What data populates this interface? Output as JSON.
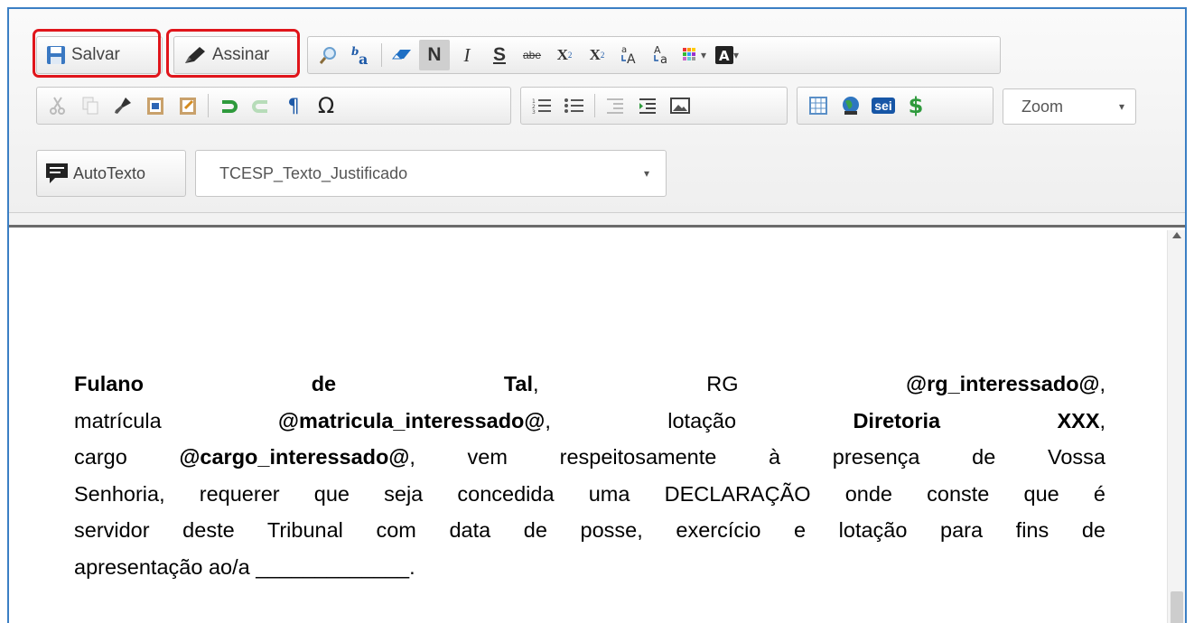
{
  "toolbar": {
    "salvar_label": "Salvar",
    "assinar_label": "Assinar",
    "bold_label": "N",
    "italic_label": "I",
    "underline_label": "S",
    "strike_label": "abe",
    "subscript_label": "X",
    "subscript_mark": "2",
    "superscript_label": "X",
    "superscript_mark": "2",
    "zoom_label": "Zoom",
    "autotexto_label": "AutoTexto",
    "style_value": "TCESP_Texto_Justificado",
    "special_char_label": "Ω",
    "pilcrow_label": "¶",
    "dollar_label": "$",
    "sei_label": "sei"
  },
  "document": {
    "line1": {
      "name_a": "Fulano",
      "name_b": "de",
      "name_c": "Tal",
      "comma1": ",",
      "rg_label": "RG",
      "rg_value": "@rg_interessado@",
      "comma2": ","
    },
    "line2": {
      "matricula_label": "matrícula",
      "matricula_value": "@matricula_interessado@",
      "comma1": ",",
      "lotacao_label": "lotação",
      "lotacao_a": "Diretoria",
      "lotacao_b": "XXX",
      "comma2": ","
    },
    "line3": {
      "cargo_label": "cargo",
      "cargo_value": "@cargo_interessado@",
      "rest": ", vem respeitosamente à presença de Vossa"
    },
    "line4": "Senhoria, requerer que seja concedida uma DECLARAÇÃO onde conste que é",
    "line5": "servidor deste Tribunal com data de posse, exercício e lotação para fins de",
    "line6": "apresentação ao/a _____________."
  },
  "colors": {
    "highlight_red": "#e0151b",
    "frame_blue": "#3b7fc4"
  },
  "icons": [
    "save-icon",
    "pen-icon",
    "find-icon",
    "replace-icon",
    "eraser-icon",
    "cut-icon",
    "copy-icon",
    "paint-brush-icon",
    "paste-word-icon",
    "paste-text-icon",
    "undo-icon",
    "redo-icon",
    "pilcrow-icon",
    "omega-icon",
    "numbered-list-icon",
    "bulleted-list-icon",
    "outdent-icon",
    "indent-icon",
    "image-icon",
    "table-icon",
    "globe-icon",
    "sei-icon",
    "dollar-icon",
    "autotext-icon",
    "color-grid-icon",
    "text-color-icon"
  ]
}
